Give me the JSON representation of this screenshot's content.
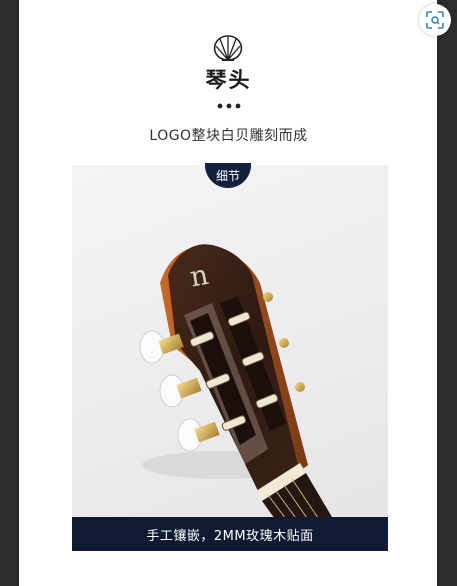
{
  "header": {
    "title": "琴头",
    "subtitle": "LOGO整块白贝雕刻而成"
  },
  "image_section": {
    "badge": "细节",
    "caption": "手工镶嵌，2MM玫瑰木贴面",
    "brand_mark": "n"
  },
  "colors": {
    "navy": "#14213d",
    "background": "#ffffff",
    "frame": "#2c2c2c"
  },
  "icons": {
    "top_right": "scan-icon",
    "header": "seashell-icon"
  }
}
